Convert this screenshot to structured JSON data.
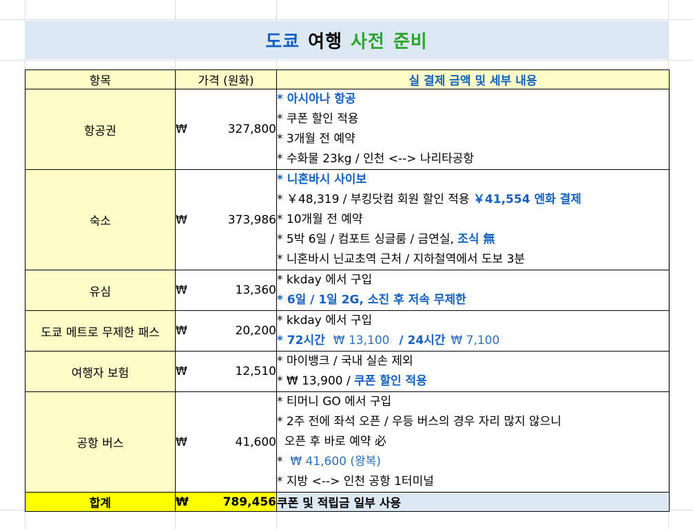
{
  "title": {
    "part1": "도쿄",
    "part2": "여행",
    "part3": "사전",
    "part4": "준비"
  },
  "colors": {
    "title_blue": "#1560bd",
    "title_black": "#000000",
    "title_green": "#2aa52a",
    "header_bg": "#fffcc7",
    "total_bg": "#ffff00",
    "title_bg": "#dce9f5"
  },
  "header": {
    "item": "항목",
    "price": "가격 (원화)",
    "detail": "실 결제 금액 및 세부 내용"
  },
  "currency": "₩",
  "rows": [
    {
      "item": "항공권",
      "price": "327,800",
      "lines": [
        {
          "t": "* 아시아나 항공"
        },
        {
          "t": "* 쿠폰 할인 적용"
        },
        {
          "t": "* 3개월 전 예약"
        },
        {
          "t": "* 수화물 23kg / 인천 <--> 나리타공항"
        }
      ]
    },
    {
      "item": "숙소",
      "price": "373,986",
      "lines": [
        {
          "t": "* 니혼바시 사이보"
        },
        {
          "a": "* ￥48,319 / 부킹닷컴 회원 할인 적용 ",
          "b": "￥41,554 엔화 결제"
        },
        {
          "t": "* 10개월 전 예약"
        },
        {
          "a": "* 5박 6일 / 컴포트 싱글룸 / 금연실, ",
          "b": "조식 無"
        },
        {
          "t": "* 니혼바시 닌교초역 근처 / 지하철역에서 도보 3분"
        }
      ]
    },
    {
      "item": "유심",
      "price": "13,360",
      "lines": [
        {
          "t": "* kkday 에서 구입"
        },
        {
          "t": "* 6일 / 1일 2G, 소진 후 저속 무제한"
        }
      ]
    },
    {
      "item": "도쿄 메트로 무제한 패스",
      "price": "20,200",
      "lines": [
        {
          "t": "* kkday 에서 구입"
        },
        {
          "a": "* 72시간",
          "b": "₩ 13,100",
          "c": " / 24시간",
          "d": "₩  7,100"
        }
      ]
    },
    {
      "item": "여행자 보험",
      "price": "12,510",
      "lines": [
        {
          "t": "* 마이뱅크 / 국내 실손 제외"
        },
        {
          "a": "* ₩ 13,900 / ",
          "b": "쿠폰 할인 적용"
        }
      ]
    },
    {
      "item": "공항 버스",
      "price": "41,600",
      "lines": [
        {
          "t": "* 티머니 GO 에서 구입"
        },
        {
          "t": "* 2주 전에 좌석 오픈 / 우등 버스의 경우 자리 많지 않으니"
        },
        {
          "t": "  오픈 후 바로 예약 必"
        },
        {
          "a": "*  ",
          "b": "₩ 41,600 (왕복)"
        },
        {
          "t": "* 지방 <--> 인천 공항 1터미널"
        }
      ]
    }
  ],
  "total": {
    "label": "합계",
    "price": "789,456",
    "detail": "쿠폰 및 적립금 일부 사용"
  }
}
